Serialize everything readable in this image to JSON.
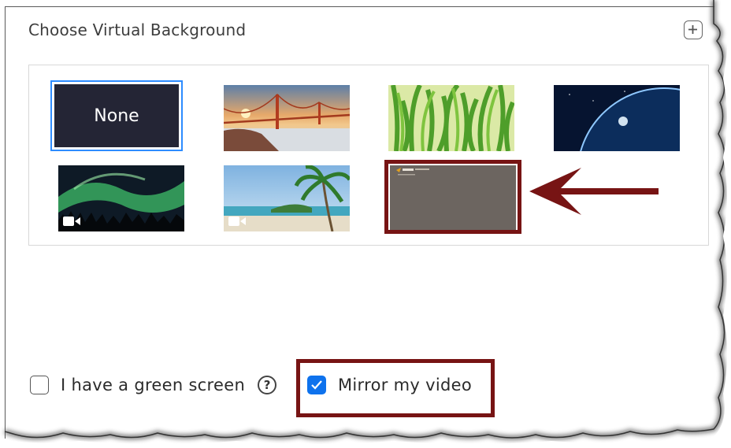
{
  "dialog": {
    "title": "Choose Virtual Background",
    "add_icon": "plus-square-icon"
  },
  "backgrounds": [
    {
      "name": "None",
      "kind": "none",
      "selected": true
    },
    {
      "name": "golden-gate-bridge",
      "kind": "image"
    },
    {
      "name": "grass",
      "kind": "image"
    },
    {
      "name": "earth-from-space",
      "kind": "image"
    },
    {
      "name": "aurora-borealis",
      "kind": "video"
    },
    {
      "name": "beach-palm",
      "kind": "video"
    },
    {
      "name": "custom-background",
      "kind": "image",
      "highlighted": true
    }
  ],
  "options": {
    "green_screen_label": "I have a green screen",
    "green_screen_checked": false,
    "help_icon": "question-circle-icon",
    "mirror_label": "Mirror my video",
    "mirror_checked": true
  },
  "colors": {
    "accent": "#2d8cff",
    "checkbox_checked": "#0e72ed",
    "annotation": "#771414",
    "none_tile_bg": "#242535",
    "custom_tile_bg": "#6c6560"
  }
}
